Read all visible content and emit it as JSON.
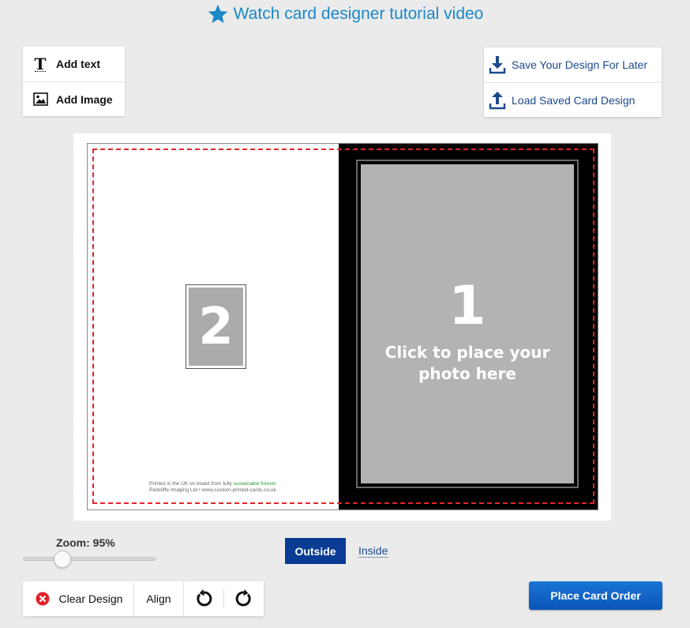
{
  "header": {
    "tutorial_link": "Watch card designer tutorial video",
    "tutorial_icon": "star-icon",
    "accent_color": "#1b88c8"
  },
  "tools": {
    "add_text": "Add text",
    "add_image": "Add Image"
  },
  "save_panel": {
    "save_label": "Save Your Design For Later",
    "load_label": "Load Saved Card Design"
  },
  "card": {
    "front_slot_number": "1",
    "front_slot_caption": "Click to place your photo here",
    "back_slot_number": "2",
    "imprint_line1_prefix": "Printed in the UK on board from fully ",
    "imprint_line1_highlight": "sustainable forests",
    "imprint_line2": "Redcliffe Imaging Ltd • www.custom-printed-cards.co.uk",
    "front_background": "#000000",
    "bleed_color": "#e2252b"
  },
  "zoom": {
    "label": "Zoom: 95%",
    "value_percent": 95
  },
  "side_tabs": {
    "outside": "Outside",
    "inside": "Inside",
    "selected": "outside"
  },
  "bottom_toolbar": {
    "clear_design": "Clear Design",
    "align": "Align"
  },
  "actions": {
    "place_order": "Place Card Order",
    "button_color": "#0a55b8"
  }
}
